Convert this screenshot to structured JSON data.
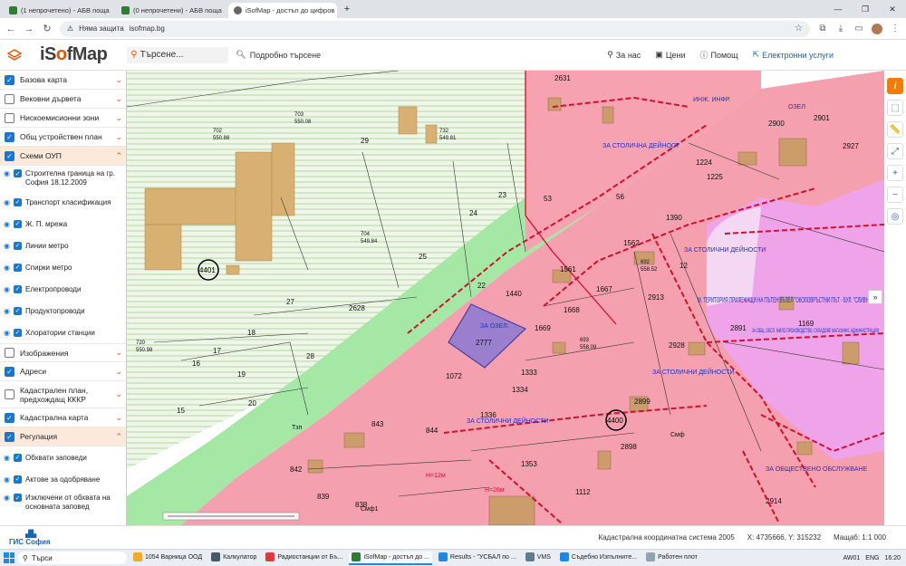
{
  "browser": {
    "tabs": [
      {
        "title": "(1 непрочетено) - АБВ поща",
        "active": false
      },
      {
        "title": "(0 непрочетени) - АБВ поща",
        "active": false
      },
      {
        "title": "iSofMap - достъп до цифров",
        "active": true
      }
    ],
    "new_tab": "+",
    "security_chip": "Няма защита",
    "url": "isofmap.bg"
  },
  "header": {
    "logo_prefix": "iS",
    "logo_o": "o",
    "logo_suffix": "fMap",
    "search_placeholder": "Търсене...",
    "advanced_search": "Подробно търсене",
    "links": {
      "about": "За нас",
      "prices": "Цени",
      "help": "Помощ",
      "eservices": "Електронни услуги"
    }
  },
  "sidebar": {
    "layers": [
      {
        "label": "Базова карта",
        "checked": true,
        "chevron": "⌄"
      },
      {
        "label": "Вековни дървета",
        "checked": false,
        "chevron": "⌄"
      },
      {
        "label": "Нискоемисионни зони",
        "checked": false,
        "chevron": "⌄"
      },
      {
        "label": "Общ устройствен план",
        "checked": true,
        "chevron": "⌄"
      },
      {
        "label": "Схеми ОУП",
        "checked": true,
        "chevron": "⌃"
      }
    ],
    "oup_sublayers": [
      {
        "label": "Строителна граница на гр. София 18.12.2009"
      },
      {
        "label": "Транспорт класификация"
      },
      {
        "label": "Ж. П. мрежа"
      },
      {
        "label": "Линии метро"
      },
      {
        "label": "Спирки метро"
      },
      {
        "label": "Електропроводи"
      },
      {
        "label": "Продуктопроводи"
      },
      {
        "label": "Хлоратории станции"
      }
    ],
    "layers2": [
      {
        "label": "Изображения",
        "checked": false,
        "chevron": "⌄"
      },
      {
        "label": "Адреси",
        "checked": true,
        "chevron": "⌄"
      },
      {
        "label": "Кадастрален план, предхождащ КККР",
        "checked": false,
        "chevron": "⌄"
      },
      {
        "label": "Кадастрална карта",
        "checked": true,
        "chevron": "⌄"
      },
      {
        "label": "Регулация",
        "checked": true,
        "chevron": "⌃"
      }
    ],
    "reg_sublayers": [
      {
        "label": "Обхвати заповеди"
      },
      {
        "label": "Актове за одобряване"
      },
      {
        "label": "Изключени от обхвата на основната заповед"
      }
    ]
  },
  "map": {
    "parcels": [
      "2631",
      "1440",
      "2777",
      "1561",
      "1562",
      "1390",
      "2928",
      "2899",
      "2898",
      "1112",
      "1353",
      "1334",
      "1333",
      "1336",
      "2628",
      "29",
      "25",
      "23",
      "24",
      "53",
      "56",
      "22",
      "27",
      "28",
      "17",
      "18",
      "16",
      "19",
      "20",
      "15",
      "843",
      "844",
      "842",
      "839",
      "838",
      "1072",
      "1668",
      "1669",
      "1667",
      "2913",
      "2914",
      "2900",
      "2901",
      "2927",
      "1169",
      "2891",
      "12",
      "1224",
      "1225"
    ],
    "building_labels": [
      "4401",
      "4400"
    ],
    "point_labels": [
      {
        "id": "702",
        "elev": "550.88"
      },
      {
        "id": "703",
        "elev": "550.08"
      },
      {
        "id": "732",
        "elev": "549.81"
      },
      {
        "id": "704",
        "elev": "549.84"
      },
      {
        "id": "720",
        "elev": "550.98"
      },
      {
        "id": "693",
        "elev": "558.09"
      },
      {
        "id": "692",
        "elev": "558.52"
      }
    ],
    "zone_labels": {
      "stolichna_1": "ЗА СТОЛИЧНА ДЕЙНОСТ",
      "stolichna_2": "ЗА СТОЛИЧНИ ДЕЙНОСТИ",
      "stolichna_3": "ЗА СТОЛИЧНИ ДЕЙНОСТИ",
      "stolichna_4": "ЗА СТОЛИЧНИ ДЕЙНОСТИ",
      "obsht_obsl": "ЗА ОБЩЕСТВЕНО ОБСЛУЖВАНЕ",
      "ozel": "ЗА ОЗЕЛ.",
      "ozel2": "ОЗЕЛ",
      "territory": "М. ТЕРИТОРИЯ ПРИЛЕЖАЩИ НА ПЪТЕН ВЪЗЕЛ \"ОКОЛОВРЪСТНИ ПЪТ - БУЛ. \"СЛИВНИЦА\"",
      "production": "ЗА ОБЩ. ОБСЛ. МИЛО ПРОИЗВОДСТВО, СКЛАДОВЕ МАГАЗИНИ, АДМИНИСТРАЦИЯ",
      "road_infr": "ИНЖ. ИНФР.",
      "height_1": "Н=12м",
      "height_2": "Н=26м"
    },
    "symbols": [
      "Тзп",
      "Смф",
      "Смф1"
    ]
  },
  "tools": {
    "info": "i",
    "select": "⬚",
    "measure": "📏",
    "fullscreen": "⤢",
    "zoom_in": "+",
    "zoom_out": "−",
    "locate": "◎",
    "collapse": "»"
  },
  "status": {
    "gis_logo_text": "ГИС София",
    "coord_system": "Кадастрална координатна система 2005",
    "coords": "X: 4735666, Y: 315232",
    "scale": "Мащаб: 1:1 000"
  },
  "taskbar": {
    "search": "Търси",
    "items": [
      {
        "label": "1054 Варница ООД",
        "color": "#f9a825"
      },
      {
        "label": "Калкулатор",
        "color": "#455a64"
      },
      {
        "label": "Радиостанции от Бъ...",
        "color": "#e53935"
      },
      {
        "label": "iSofMap - достъп до ...",
        "color": "#2e7d32",
        "active": true
      },
      {
        "label": "Results - \"УСБАЛ по ...",
        "color": "#1e88e5"
      },
      {
        "label": "VMS",
        "color": "#607d8b"
      },
      {
        "label": "Съдебно Изпълните...",
        "color": "#1e88e5"
      },
      {
        "label": "Работен плот",
        "color": "#90a4ae"
      }
    ],
    "tray": {
      "weather": "AW01",
      "lang": "ENG",
      "time": "16:20"
    }
  }
}
